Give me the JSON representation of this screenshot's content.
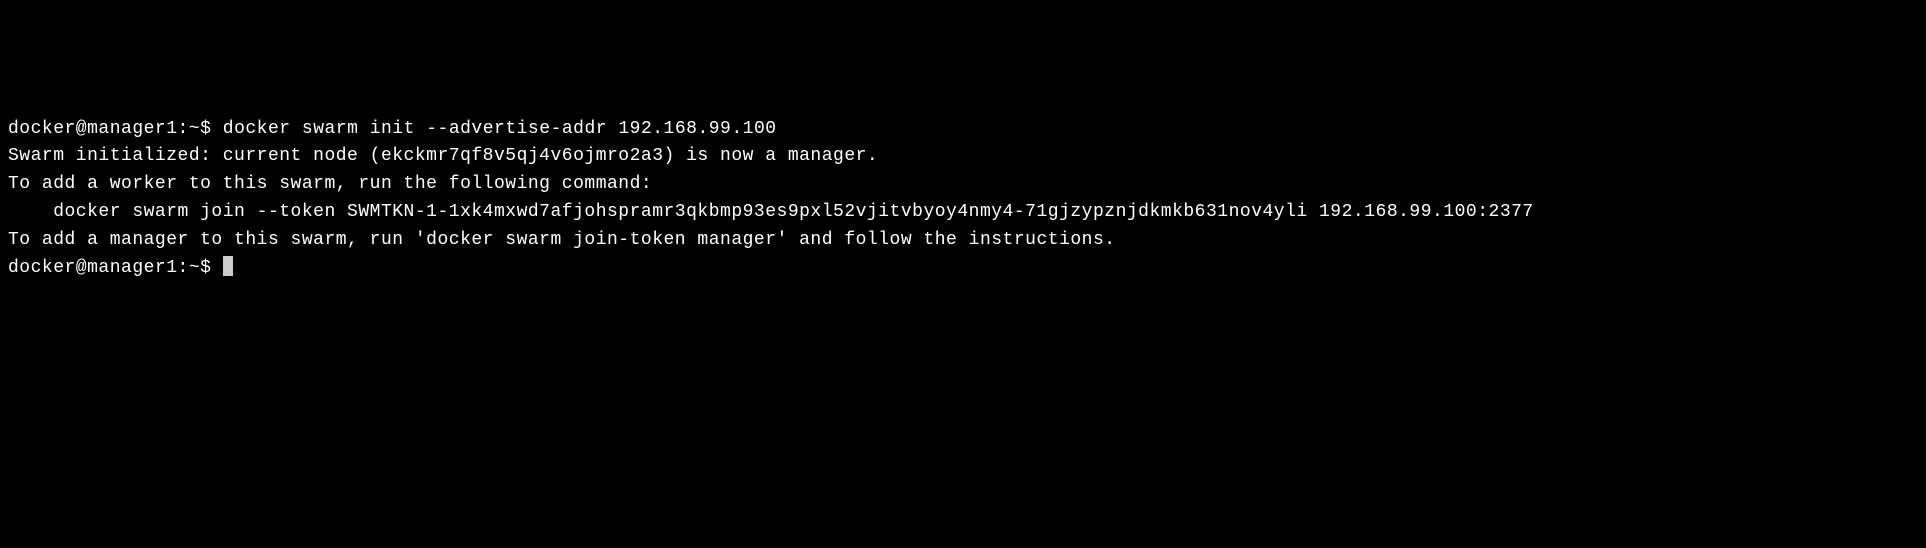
{
  "terminal": {
    "prompt1_user_host": "docker@manager1",
    "prompt1_path": "~",
    "prompt1_symbol": "$",
    "command": "docker swarm init --advertise-addr 192.168.99.100",
    "output_line1": "Swarm initialized: current node (ekckmr7qf8v5qj4v6ojmro2a3) is now a manager.",
    "output_line2": "",
    "output_line3": "To add a worker to this swarm, run the following command:",
    "output_line4": "",
    "output_line5": "    docker swarm join --token SWMTKN-1-1xk4mxwd7afjohspramr3qkbmp93es9pxl52vjitvbyoy4nmy4-71gjzypznjdkmkb631nov4yli 192.168.99.100:2377",
    "output_line6": "",
    "output_line7": "To add a manager to this swarm, run 'docker swarm join-token manager' and follow the instructions.",
    "output_line8": "",
    "prompt2_user_host": "docker@manager1",
    "prompt2_path": "~",
    "prompt2_symbol": "$"
  }
}
